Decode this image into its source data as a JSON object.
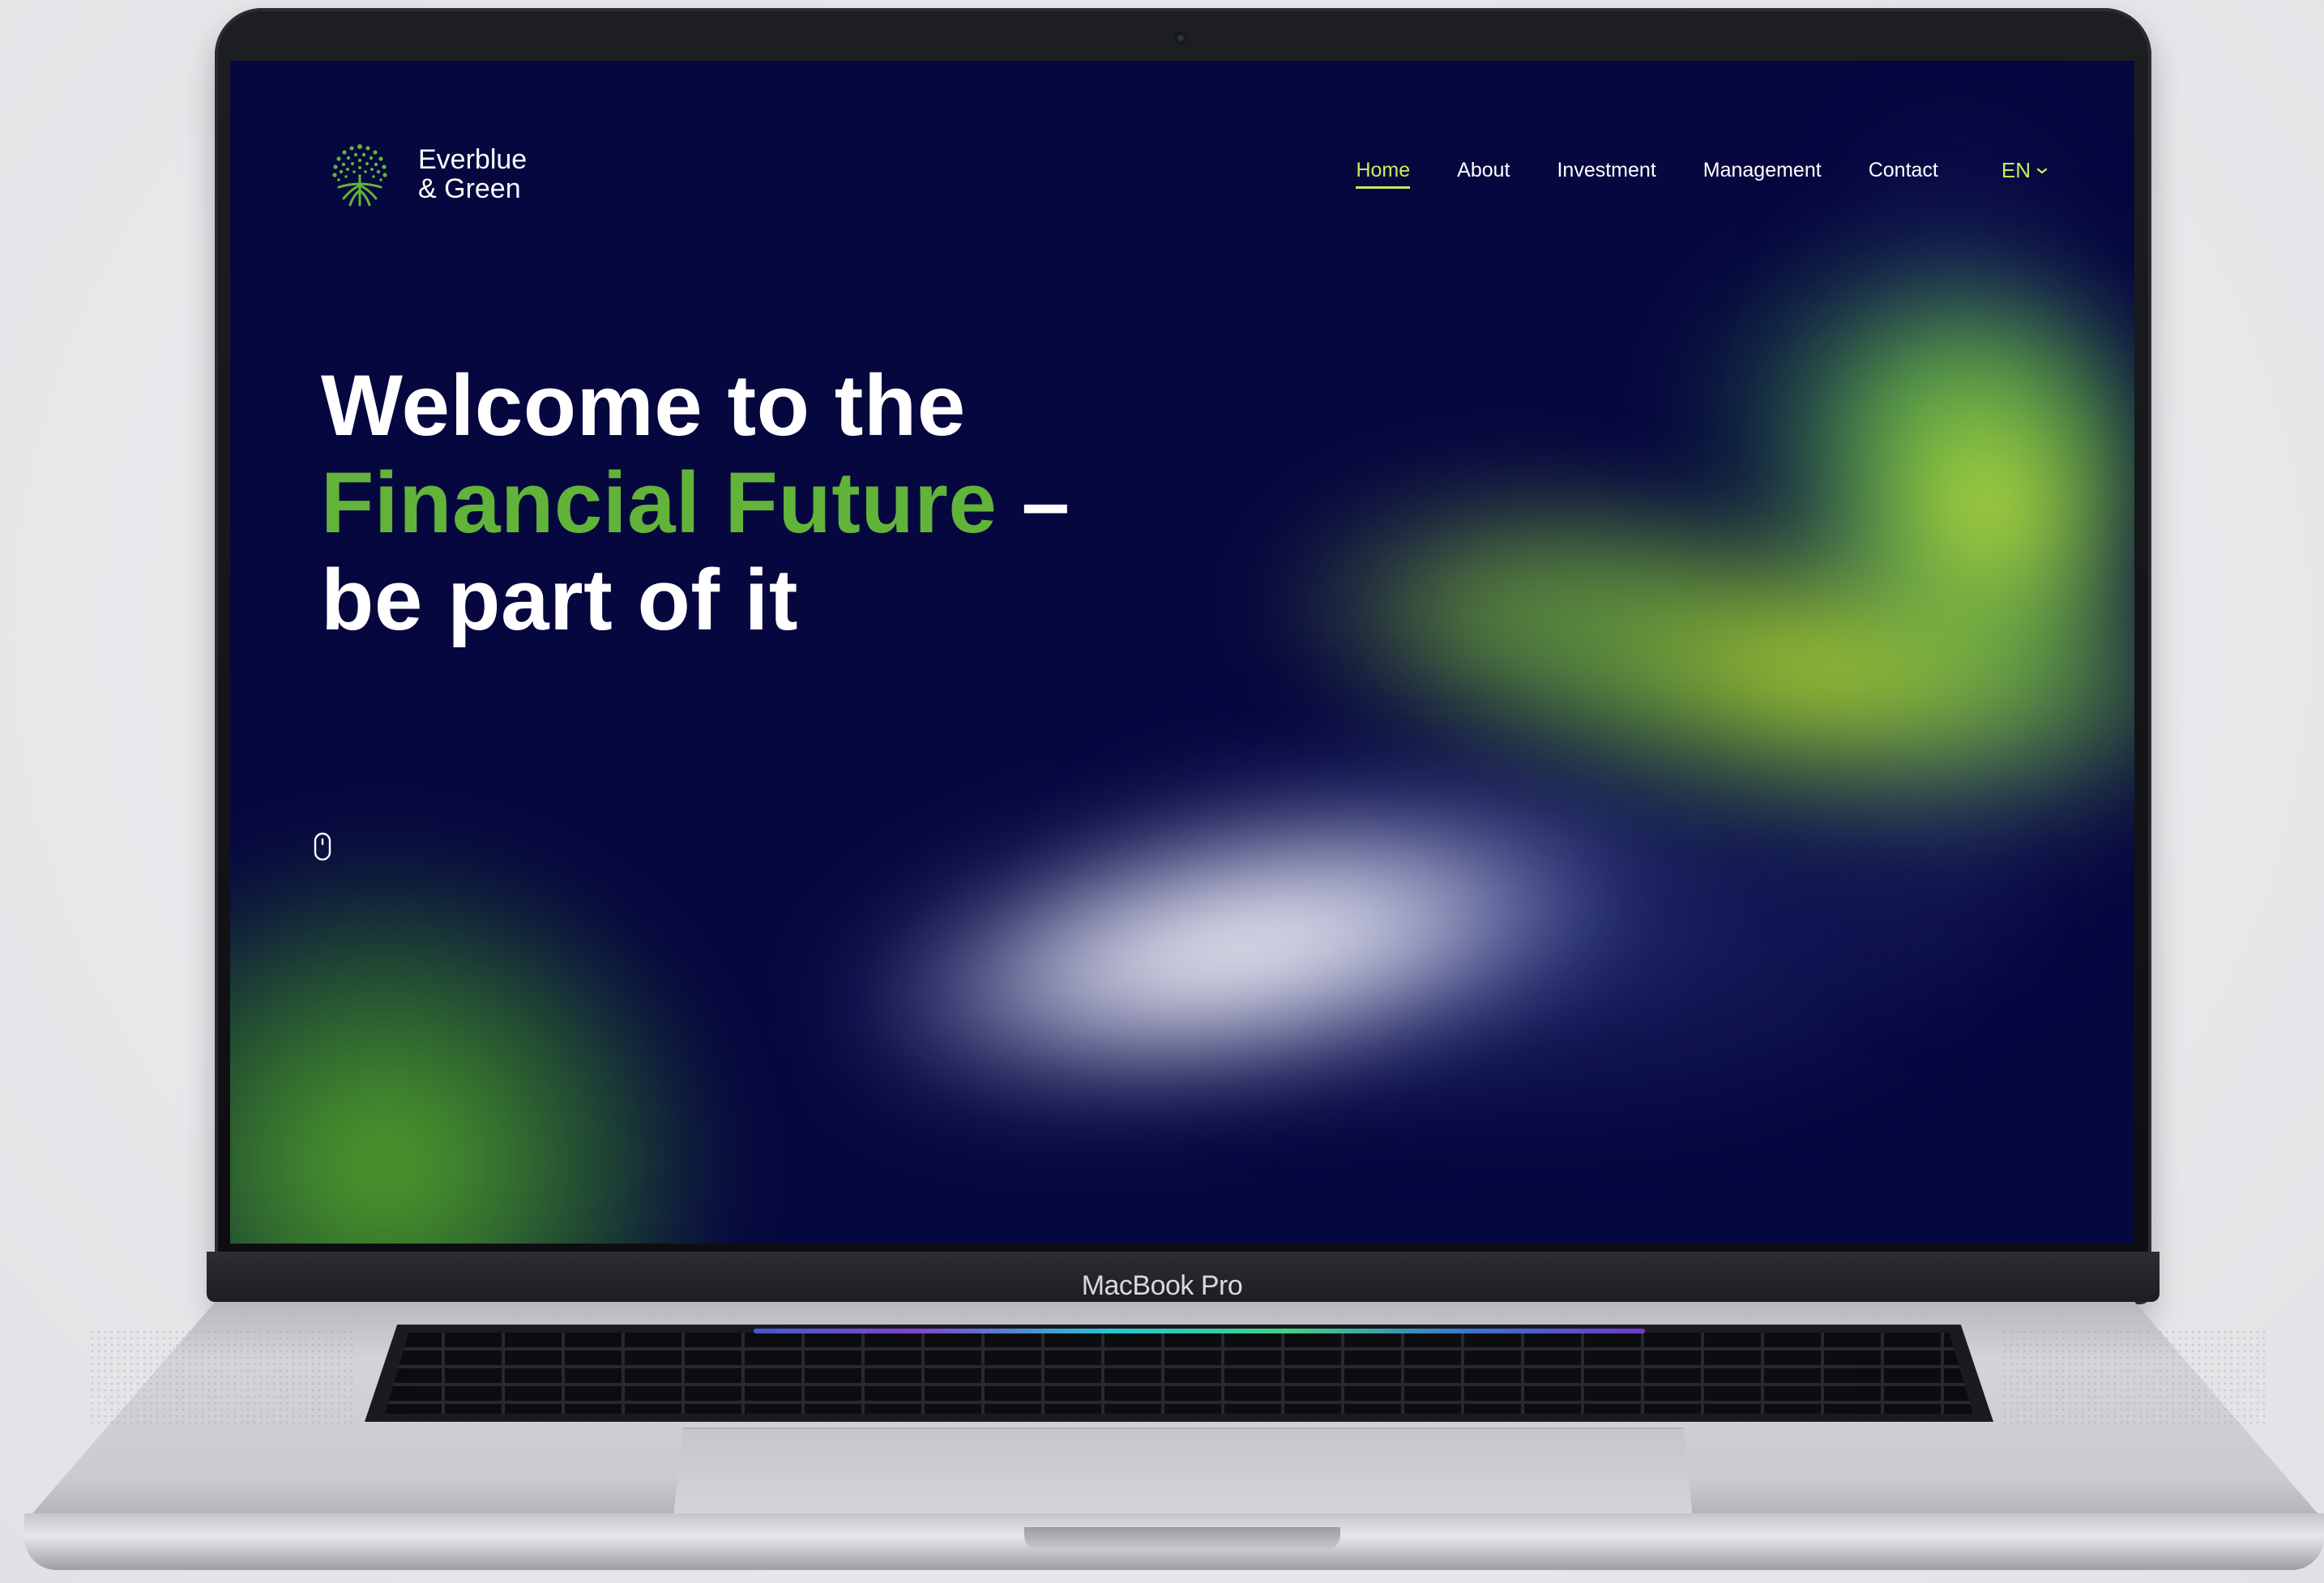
{
  "site": {
    "logo": {
      "line1": "Everblue",
      "line2": "& Green",
      "icon": "tree-roots-icon"
    },
    "nav": {
      "items": [
        {
          "label": "Home",
          "active": true
        },
        {
          "label": "About",
          "active": false
        },
        {
          "label": "Investment",
          "active": false
        },
        {
          "label": "Management",
          "active": false
        },
        {
          "label": "Contact",
          "active": false
        }
      ],
      "language": "EN",
      "language_icon": "chevron-down-icon"
    },
    "hero": {
      "line1": "Welcome to the",
      "line2_highlight": "Financial Future",
      "line2_suffix": " –",
      "line3": "be part of it"
    },
    "scroll_indicator": "mouse-scroll-icon"
  },
  "device": {
    "brand_label": "MacBook Pro"
  },
  "colors": {
    "accent_green": "#62b33a",
    "nav_active": "#c5f15a",
    "background_navy": "#06073f"
  }
}
